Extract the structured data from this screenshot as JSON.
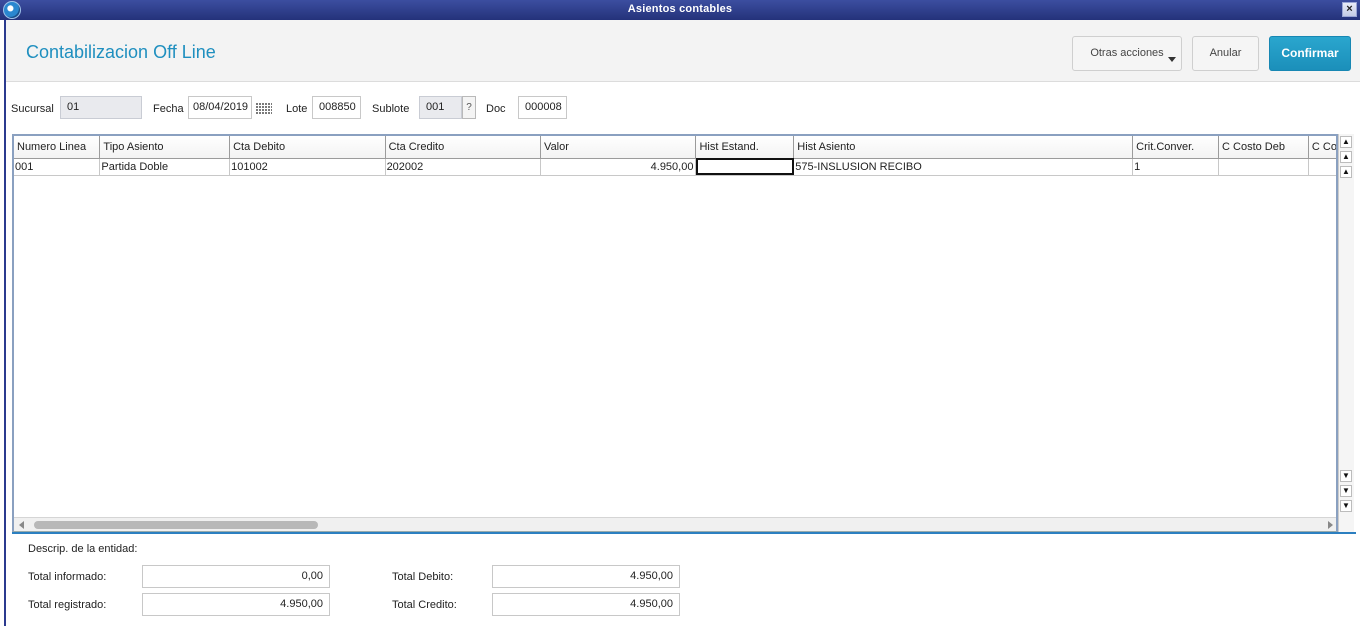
{
  "window": {
    "title": "Asientos contables",
    "close": "×"
  },
  "header": {
    "title": "Contabilizacion Off Line",
    "buttons": {
      "otras": "Otras acciones",
      "anular": "Anular",
      "confirmar": "Confirmar"
    }
  },
  "form": {
    "sucursal_label": "Sucursal",
    "sucursal_value": "01",
    "fecha_label": "Fecha",
    "fecha_value": "08/04/2019",
    "lote_label": "Lote",
    "lote_value": "008850",
    "sublote_label": "Sublote",
    "sublote_value": "001",
    "sublote_lookup": "?",
    "doc_label": "Doc",
    "doc_value": "000008"
  },
  "grid": {
    "columns": [
      "Numero Linea",
      "Tipo Asiento",
      "Cta Debito",
      "Cta Credito",
      "Valor",
      "Hist Estand.",
      "Hist Asiento",
      "Crit.Conver.",
      "C Costo Deb",
      "C Co"
    ],
    "rows": [
      [
        "001",
        "Partida Doble",
        "101002",
        "202002",
        "4.950,00",
        "",
        "575-INSLUSION RECIBO",
        "1",
        "",
        ""
      ]
    ]
  },
  "footer": {
    "descrip_label": "Descrip. de la entidad:",
    "total_informado_label": "Total informado:",
    "total_informado_value": "0,00",
    "total_registrado_label": "Total registrado:",
    "total_registrado_value": "4.950,00",
    "total_debito_label": "Total Debito:",
    "total_debito_value": "4.950,00",
    "total_credito_label": "Total Credito:",
    "total_credito_value": "4.950,00"
  },
  "colors": {
    "accent": "#1f8fbf",
    "confirm_button": "#1b8fba",
    "titlebar": "#2b3a8f"
  }
}
